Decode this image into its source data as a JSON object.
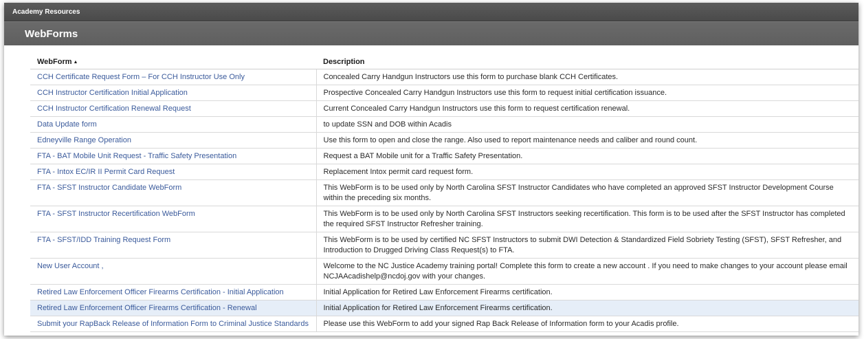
{
  "top_bar": {
    "title": "Academy Resources"
  },
  "section": {
    "title": "WebForms"
  },
  "table": {
    "headers": {
      "webform": "WebForm",
      "description": "Description"
    },
    "sort_indicator": "▲",
    "rows": [
      {
        "webform": "CCH Certificate Request Form – For CCH Instructor Use Only",
        "description": "Concealed Carry Handgun Instructors use this form to purchase blank CCH Certificates."
      },
      {
        "webform": "CCH Instructor Certification Initial Application",
        "description": "Prospective Concealed Carry Handgun Instructors use this form to request initial certification issuance."
      },
      {
        "webform": "CCH Instructor Certification Renewal Request",
        "description": "Current Concealed Carry Handgun Instructors use this form to request certification renewal."
      },
      {
        "webform": "Data Update form",
        "description": "to update SSN and DOB within Acadis"
      },
      {
        "webform": "Edneyville Range Operation",
        "description": "Use this form to open and close the range. Also used to report maintenance needs and caliber and round count."
      },
      {
        "webform": "FTA - BAT Mobile Unit Request - Traffic Safety Presentation",
        "description": "Request a BAT Mobile unit for a Traffic Safety Presentation."
      },
      {
        "webform": "FTA - Intox EC/IR II Permit Card Request",
        "description": "Replacement Intox permit card request form."
      },
      {
        "webform": "FTA - SFST Instructor Candidate WebForm",
        "description": "This WebForm is to be used only by North Carolina SFST Instructor Candidates who have completed an approved SFST Instructor Development Course within the preceding six months."
      },
      {
        "webform": "FTA - SFST Instructor Recertification WebForm",
        "description": "This WebForm is to be used only by North Carolina SFST Instructors seeking recertification. This form is to be used after the SFST Instructor has completed the required SFST Instructor Refresher training."
      },
      {
        "webform": "FTA - SFST/IDD Training Request Form",
        "description": "This WebForm is to be used by certified NC SFST Instructors to submit DWI Detection & Standardized Field Sobriety Testing (SFST), SFST Refresher, and Introduction to Drugged Driving Class Request(s) to FTA."
      },
      {
        "webform": "New User Account ,",
        "description": "Welcome to the NC Justice Academy training portal! Complete this form to create a new account . If you need to make changes to your account please email NCJAAcadishelp@ncdoj.gov with your changes."
      },
      {
        "webform": "Retired Law Enforcement Officer Firearms Certification - Initial Application",
        "description": "Initial Application for Retired Law Enforcement Firearms certification."
      },
      {
        "webform": "Retired Law Enforcement Officer Firearms Certification - Renewal",
        "description": "Initial Application for Retired Law Enforcement Firearms certification."
      },
      {
        "webform": "Submit your RapBack Release of Information Form to Criminal Justice Standards",
        "description": "Please use this WebForm to add your signed Rap Back Release of Information form to your Acadis profile."
      }
    ]
  },
  "colors": {
    "link": "#3a5a9b",
    "header_bg": "#5f5f5f",
    "highlight_row": "#e6eef8"
  }
}
